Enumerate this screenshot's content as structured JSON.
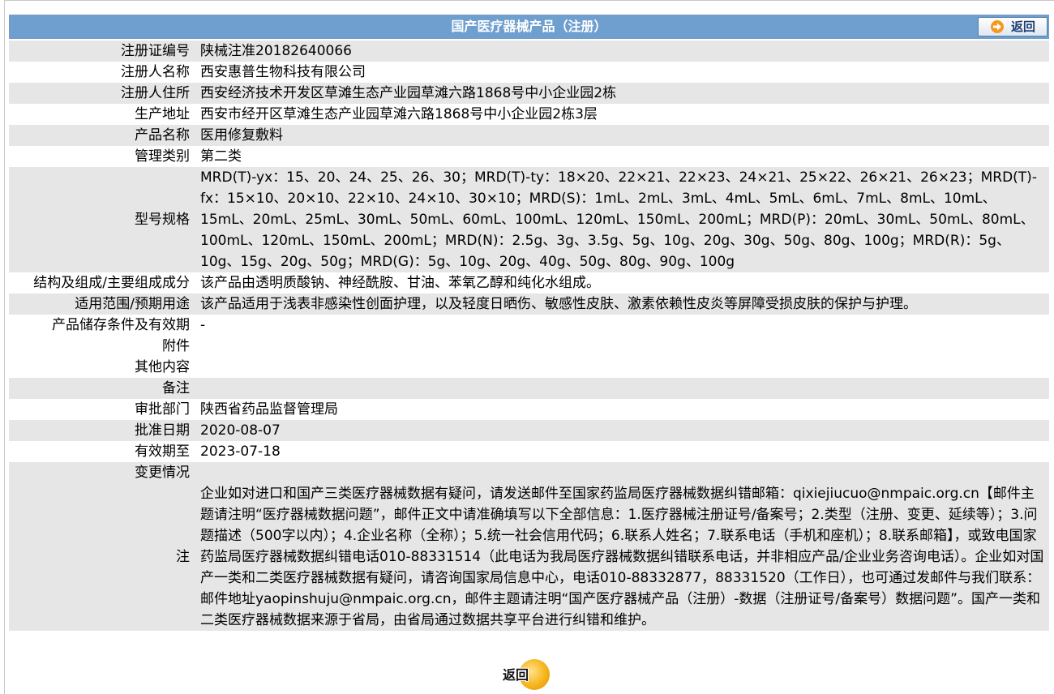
{
  "header": {
    "title": "国产医疗器械产品（注册）",
    "back_label": "返回"
  },
  "fields": {
    "reg_no": {
      "label": "注册证编号",
      "value": "陕械注准20182640066"
    },
    "registrant": {
      "label": "注册人名称",
      "value": "西安惠普生物科技有限公司"
    },
    "registrant_address": {
      "label": "注册人住所",
      "value": "西安经济技术开发区草滩生态产业园草滩六路1868号中小企业园2栋"
    },
    "production_address": {
      "label": "生产地址",
      "value": "西安市经开区草滩生态产业园草滩六路1868号中小企业园2栋3层"
    },
    "product_name": {
      "label": "产品名称",
      "value": "医用修复敷料"
    },
    "category": {
      "label": "管理类别",
      "value": "第二类"
    },
    "model_spec": {
      "label": "型号规格",
      "value": "MRD(T)-yx：15、20、24、25、26、30；MRD(T)-ty：18×20、22×21、22×23、24×21、25×22、26×21、26×23；MRD(T)-fx：15×10、20×10、22×10、24×10、30×10；MRD(S)：1mL、2mL、3mL、4mL、5mL、6mL、7mL、8mL、10mL、15mL、20mL、25mL、30mL、50mL、60mL、100mL、120mL、150mL、200mL；MRD(P)：20mL、30mL、50mL、80mL、100mL、120mL、150mL、200mL；MRD(N)：2.5g、3g、3.5g、5g、10g、20g、30g、50g、80g、100g；MRD(R)：5g、10g、15g、20g、50g；MRD(G)：5g、10g、20g、40g、50g、80g、90g、100g"
    },
    "composition": {
      "label": "结构及组成/主要组成成分",
      "value": "该产品由透明质酸钠、神经酰胺、甘油、苯氧乙醇和纯化水组成。"
    },
    "intended_use": {
      "label": "适用范围/预期用途",
      "value": "该产品适用于浅表非感染性创面护理，以及轻度日晒伤、敏感性皮肤、激素依赖性皮炎等屏障受损皮肤的保护与护理。"
    },
    "storage": {
      "label": "产品储存条件及有效期",
      "value": "-"
    },
    "attachment": {
      "label": "附件",
      "value": ""
    },
    "other": {
      "label": "其他内容",
      "value": ""
    },
    "remarks": {
      "label": "备注",
      "value": ""
    },
    "approval_dept": {
      "label": "审批部门",
      "value": "陕西省药品监督管理局"
    },
    "approval_date": {
      "label": "批准日期",
      "value": "2020-08-07"
    },
    "valid_until": {
      "label": "有效期至",
      "value": "2023-07-18"
    },
    "changes": {
      "label": "变更情况",
      "value": ""
    },
    "note": {
      "label": "注",
      "value": "企业如对进口和国产三类医疗器械数据有疑问，请发送邮件至国家药监局医疗器械数据纠错邮箱：qixiejiucuo@nmpaic.org.cn【邮件主题请注明“医疗器械数据问题”，邮件正文中请准确填写以下全部信息：1.医疗器械注册证号/备案号；2.类型（注册、变更、延续等）；3.问题描述（500字以内）；4.企业名称（全称）；5.统一社会信用代码；6.联系人姓名；7.联系电话（手机和座机）；8.联系邮箱】，或致电国家药监局医疗器械数据纠错电话010-88331514（此电话为我局医疗器械数据纠错联系电话，并非相应产品/企业业务咨询电话）。企业如对国产一类和二类医疗器械数据有疑问，请咨询国家局信息中心，电话010-88332877，88331520（工作日），也可通过发邮件与我们联系：邮件地址yaopinshuju@nmpaic.org.cn，邮件主题请注明“国产医疗器械产品（注册）-数据（注册证号/备案号）数据问题”。国产一类和二类医疗器械数据来源于省局，由省局通过数据共享平台进行纠错和维护。"
    }
  },
  "footer": {
    "back_label": "返回"
  },
  "colors": {
    "header_bg": "#6e9fcf",
    "row_alt_bg": "#e6e6e6",
    "back_button_accent": "#f6b51c"
  },
  "icons": {
    "header_back": "arrow-right-icon",
    "footer_back": "orange-circle-icon"
  }
}
